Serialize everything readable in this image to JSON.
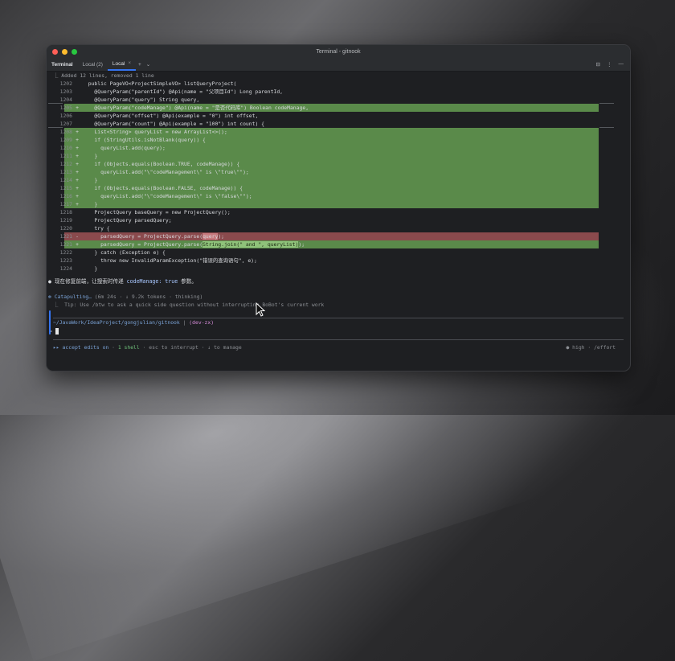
{
  "window": {
    "title": "Terminal - gitnook"
  },
  "tabbar": {
    "label": "Terminal",
    "tabs": [
      {
        "label": "Local (2)",
        "active": false
      },
      {
        "label": "Local",
        "active": true
      }
    ],
    "close_glyph": "×",
    "add_glyph": "+",
    "dropdown_glyph": "⌄",
    "right_icons": [
      "⊟",
      "⋮",
      "—"
    ]
  },
  "diff": {
    "header": "⎿ Added 12 lines, removed 1 line",
    "lines": [
      {
        "n": "1202",
        "mark": "",
        "type": "ctx",
        "text": "  public PageVO<ProjectSimpleVO> listQueryProject("
      },
      {
        "n": "1203",
        "mark": "",
        "type": "ctx",
        "text": "    @QueryParam(\"parentId\") @Api(name = \"父项目Id\") Long parentId,"
      },
      {
        "n": "1204",
        "mark": "",
        "type": "ctx",
        "text": "    @QueryParam(\"query\") String query,"
      },
      {
        "n": "1205",
        "mark": "+",
        "type": "add",
        "text": "    @QueryParam(\"codeManage\") @Api(name = \"是否代码库\") Boolean codeManage,"
      },
      {
        "n": "1206",
        "mark": "",
        "type": "ctx",
        "text": "    @QueryParam(\"offset\") @Api(example = \"0\") int offset,"
      },
      {
        "n": "1207",
        "mark": "",
        "type": "ctx",
        "text": "    @QueryParam(\"count\") @Api(example = \"100\") int count) {"
      },
      {
        "n": "1208",
        "mark": "+",
        "type": "add",
        "text": "    List<String> queryList = new ArrayList<>();"
      },
      {
        "n": "1209",
        "mark": "+",
        "type": "add",
        "text": "    if (StringUtils.isNotBlank(query)) {"
      },
      {
        "n": "1210",
        "mark": "+",
        "type": "add",
        "text": "      queryList.add(query);"
      },
      {
        "n": "1211",
        "mark": "+",
        "type": "add",
        "text": "    }"
      },
      {
        "n": "1212",
        "mark": "+",
        "type": "add",
        "text": "    if (Objects.equals(Boolean.TRUE, codeManage)) {"
      },
      {
        "n": "1213",
        "mark": "+",
        "type": "add",
        "text": "      queryList.add(\"\\\"codeManagement\\\" is \\\"true\\\"\");"
      },
      {
        "n": "1214",
        "mark": "+",
        "type": "add",
        "text": "    }"
      },
      {
        "n": "1215",
        "mark": "+",
        "type": "add",
        "text": "    if (Objects.equals(Boolean.FALSE, codeManage)) {"
      },
      {
        "n": "1216",
        "mark": "+",
        "type": "add",
        "text": "      queryList.add(\"\\\"codeManagement\\\" is \\\"false\\\"\");"
      },
      {
        "n": "1217",
        "mark": "+",
        "type": "add",
        "text": "    }"
      },
      {
        "n": "1218",
        "mark": "",
        "type": "ctx",
        "text": "    ProjectQuery baseQuery = new ProjectQuery();"
      },
      {
        "n": "1219",
        "mark": "",
        "type": "ctx",
        "text": "    ProjectQuery parsedQuery;"
      },
      {
        "n": "1220",
        "mark": "",
        "type": "ctx",
        "text": "    try {"
      },
      {
        "n": "1221",
        "mark": "-",
        "type": "rem",
        "pre": "      parsedQuery = ProjectQuery.parse(",
        "hl": "query",
        "post": ");"
      },
      {
        "n": "1221",
        "mark": "+",
        "type": "add2",
        "pre": "      parsedQuery = ProjectQuery.parse(",
        "hl": "String.join(\" and \", queryList)",
        "post": ");"
      },
      {
        "n": "1222",
        "mark": "",
        "type": "ctx",
        "text": "    } catch (Exception e) {"
      },
      {
        "n": "1223",
        "mark": "",
        "type": "ctx",
        "text": "      throw new InvalidParamException(\"错误的查询语句\", e);"
      },
      {
        "n": "1224",
        "mark": "",
        "type": "ctx",
        "text": "    }"
      }
    ]
  },
  "message": {
    "bullet": "●",
    "pre": " 现在修复前端，让搜索时传递 ",
    "code": "codeManage: true",
    "post": " 参数。"
  },
  "status": {
    "spinner": "✻",
    "label": "Catapulting…",
    "detail": " (6m 24s · ↓ 9.2k tokens · thinking)",
    "tip": "⎿  Tip: Use /btw to ask a quick side question without interrupting BoBot's current work"
  },
  "prompt": {
    "path": "~/JavaWork/IdeaProject/gongjulian/gitnook",
    "separator": " | ",
    "branch": "(dev-zx)",
    "symbol": "> "
  },
  "footer": {
    "arrows": "▸▸",
    "mode": " accept edits on",
    "dot1": " · ",
    "shell": "1 shell",
    "rest": " · esc to interrupt · ↓ to manage",
    "effort": "● high · /effort"
  },
  "colors": {
    "added": "#5a8a4a",
    "removed": "#8a4a4d",
    "accent": "#3574f0"
  }
}
